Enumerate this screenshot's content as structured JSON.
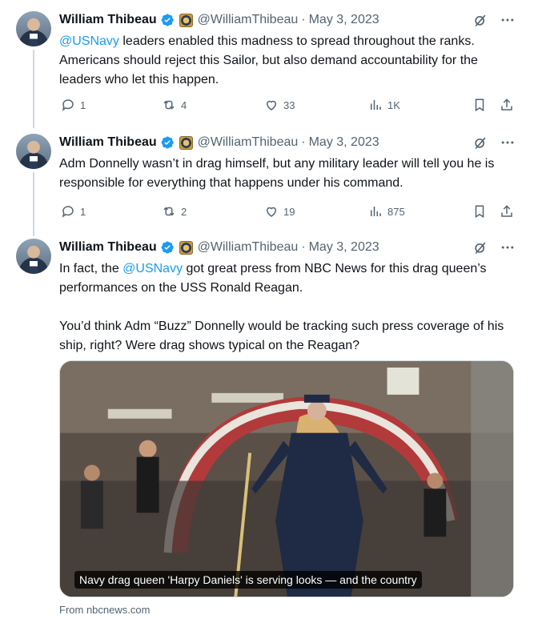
{
  "colors": {
    "link": "#1d9bf0",
    "muted": "#536471",
    "verified": "#1d9bf0"
  },
  "tweets": [
    {
      "author_name": "William Thibeau",
      "author_handle": "@WilliamThibeau",
      "dot": "·",
      "date": "May 3, 2023",
      "mention": "@USNavy",
      "text_after_mention": " leaders enabled this madness to spread throughout the ranks. Americans should reject this Sailor, but also demand accountability for the leaders who let this happen.",
      "replies": "1",
      "reposts": "4",
      "likes": "33",
      "views": "1K"
    },
    {
      "author_name": "William Thibeau",
      "author_handle": "@WilliamThibeau",
      "dot": "·",
      "date": "May 3, 2023",
      "text": "Adm Donnelly wasn’t in drag himself, but any military leader will tell you he is responsible for everything that happens under his command.",
      "replies": "1",
      "reposts": "2",
      "likes": "19",
      "views": "875"
    },
    {
      "author_name": "William Thibeau",
      "author_handle": "@WilliamThibeau",
      "dot": "·",
      "date": "May 3, 2023",
      "text_before_mention": "In fact, the ",
      "mention": "@USNavy",
      "text_after_mention": " got great press from NBC News for this drag queen’s performances on the USS Ronald Reagan.\n\nYou’d think Adm “Buzz” Donnelly would be tracking such press coverage of his ship, right? Were drag shows typical on the Reagan?",
      "media_caption": "Navy drag queen 'Harpy Daniels' is serving looks — and the country",
      "source": "From nbcnews.com"
    }
  ]
}
